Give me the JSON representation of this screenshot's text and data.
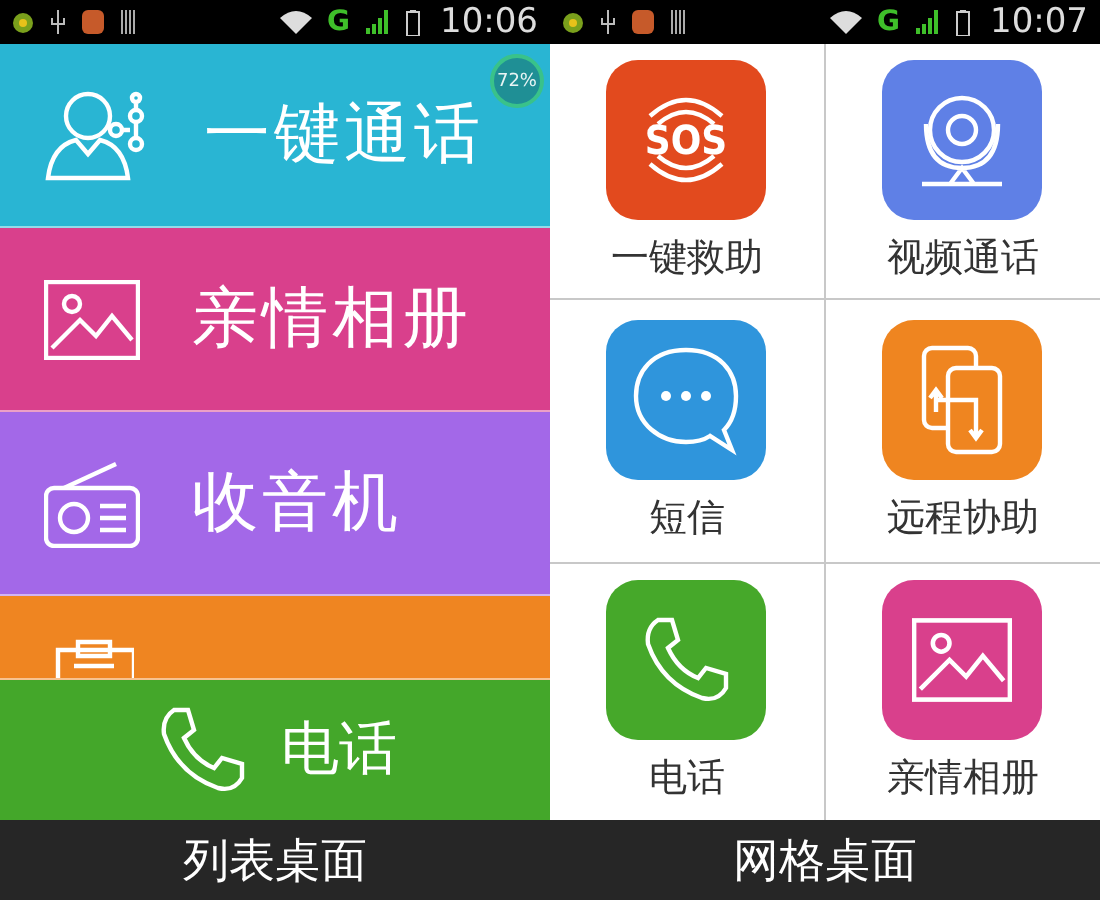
{
  "list_screen": {
    "status_bar": {
      "network": "G",
      "time": "10:06"
    },
    "battery_badge": "72%",
    "items": [
      {
        "label": "一键通话",
        "color": "#29b5d3"
      },
      {
        "label": "亲情相册",
        "color": "#d9408c"
      },
      {
        "label": "收音机",
        "color": "#a368e8"
      },
      {
        "color": "#ef8521"
      }
    ],
    "call_bar": {
      "label": "电话"
    },
    "caption": "列表桌面"
  },
  "grid_screen": {
    "status_bar": {
      "network": "G",
      "time": "10:07"
    },
    "tiles": [
      {
        "label": "一键救助",
        "color": "#e24a1e",
        "icon_text": "SOS"
      },
      {
        "label": "视频通话",
        "color": "#5f80e6"
      },
      {
        "label": "短信",
        "color": "#2f95dc"
      },
      {
        "label": "远程协助",
        "color": "#ef8520"
      },
      {
        "label": "电话",
        "color": "#46a82a"
      },
      {
        "label": "亲情相册",
        "color": "#d9408c"
      }
    ],
    "caption": "网格桌面"
  }
}
